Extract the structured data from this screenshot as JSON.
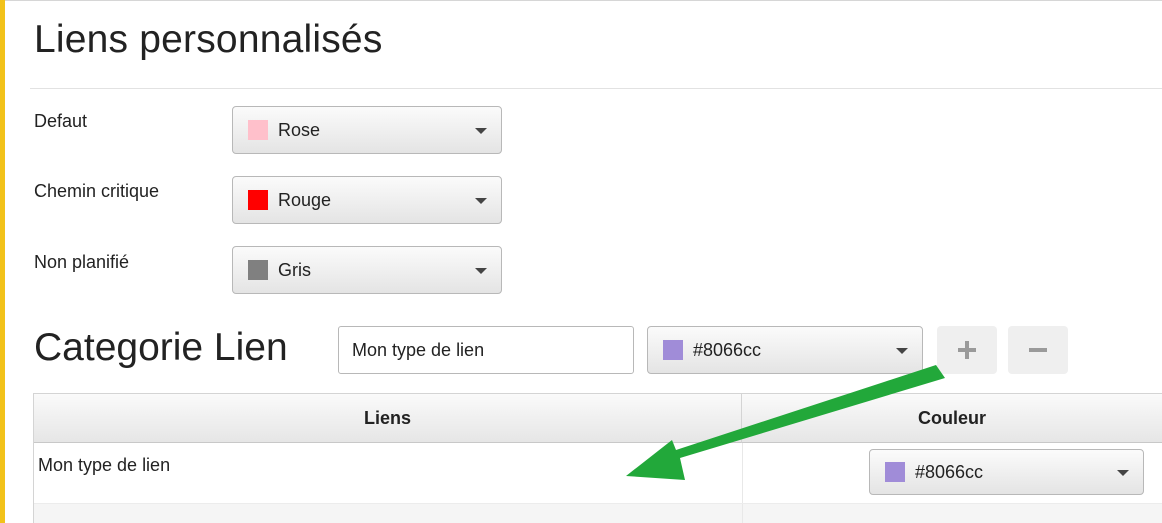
{
  "title": "Liens personnalisés",
  "settings": [
    {
      "label": "Defaut",
      "value": "Rose",
      "color": "#ffc0cb"
    },
    {
      "label": "Chemin critique",
      "value": "Rouge",
      "color": "#ff0000"
    },
    {
      "label": "Non planifié",
      "value": "Gris",
      "color": "#808080"
    }
  ],
  "category": {
    "title": "Categorie Lien",
    "name_value": "Mon type de lien",
    "color_value": "#8066cc",
    "color": "#a08cd8",
    "add_icon": "plus-icon",
    "remove_icon": "minus-icon"
  },
  "table": {
    "columns": [
      "Liens",
      "Couleur"
    ],
    "rows": [
      {
        "lien": "Mon type de lien",
        "couleur": "#8066cc",
        "color": "#a08cd8"
      }
    ]
  },
  "annotation_color": "#22a83a"
}
